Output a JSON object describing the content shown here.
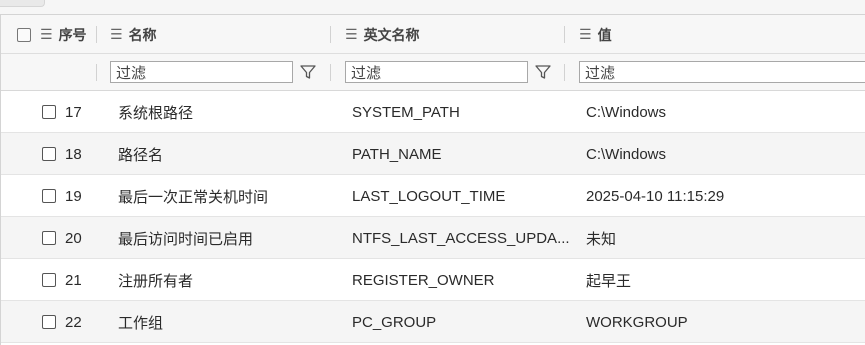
{
  "header": {
    "columns": [
      {
        "label": "序号"
      },
      {
        "label": "名称"
      },
      {
        "label": "英文名称"
      },
      {
        "label": "值"
      }
    ],
    "icons": {
      "column_menu": "list-icon",
      "filter": "funnel-icon"
    }
  },
  "filters": {
    "name_placeholder": "过滤",
    "en_placeholder": "过滤",
    "value_placeholder": "过滤"
  },
  "rows": [
    {
      "index": "17",
      "name": "系统根路径",
      "en": "SYSTEM_PATH",
      "value": "C:\\Windows"
    },
    {
      "index": "18",
      "name": "路径名",
      "en": "PATH_NAME",
      "value": "C:\\Windows"
    },
    {
      "index": "19",
      "name": "最后一次正常关机时间",
      "en": "LAST_LOGOUT_TIME",
      "value": "2025-04-10 11:15:29"
    },
    {
      "index": "20",
      "name": "最后访问时间已启用",
      "en": "NTFS_LAST_ACCESS_UPDA...",
      "value": "未知"
    },
    {
      "index": "21",
      "name": "注册所有者",
      "en": "REGISTER_OWNER",
      "value": "起早王"
    },
    {
      "index": "22",
      "name": "工作组",
      "en": "PC_GROUP",
      "value": "WORKGROUP"
    }
  ]
}
